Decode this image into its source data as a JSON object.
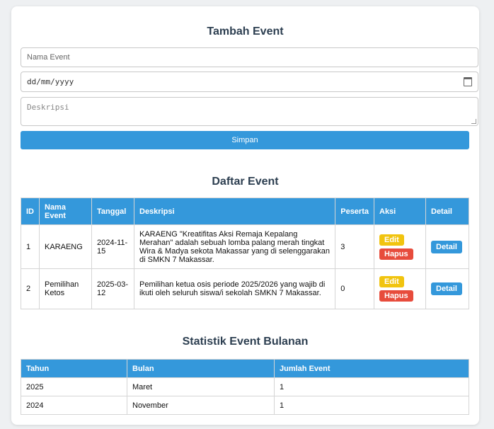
{
  "add": {
    "title": "Tambah Event",
    "name_placeholder": "Nama Event",
    "date_placeholder": "dd/mm/yyyy",
    "desc_placeholder": "Deskripsi",
    "save_label": "Simpan"
  },
  "list": {
    "title": "Daftar Event",
    "headers": [
      "ID",
      "Nama Event",
      "Tanggal",
      "Deskripsi",
      "Peserta",
      "Aksi",
      "Detail"
    ],
    "rows": [
      {
        "id": "1",
        "name": "KARAENG",
        "date": "2024-11-15",
        "desc": "KARAENG \"Kreatifitas Aksi Remaja Kepalang Merahan\" adalah sebuah lomba palang merah tingkat Wira & Madya sekota Makassar yang di selenggarakan di SMKN 7 Makassar.",
        "peserta": "3"
      },
      {
        "id": "2",
        "name": "Pemilihan Ketos",
        "date": "2025-03-12",
        "desc": "Pemilihan ketua osis periode 2025/2026 yang wajib di ikuti oleh seluruh siswa/i sekolah SMKN 7 Makassar.",
        "peserta": "0"
      }
    ],
    "edit_label": "Edit",
    "delete_label": "Hapus",
    "detail_label": "Detail"
  },
  "stats": {
    "title": "Statistik Event Bulanan",
    "headers": [
      "Tahun",
      "Bulan",
      "Jumlah Event"
    ],
    "rows": [
      {
        "tahun": "2025",
        "bulan": "Maret",
        "jumlah": "1"
      },
      {
        "tahun": "2024",
        "bulan": "November",
        "jumlah": "1"
      }
    ]
  },
  "colors": {
    "primary": "#3498db",
    "edit": "#f1c40f",
    "delete": "#e74c3c",
    "heading": "#2c3e50"
  },
  "icons": {
    "date_picker": "calendar-icon"
  }
}
